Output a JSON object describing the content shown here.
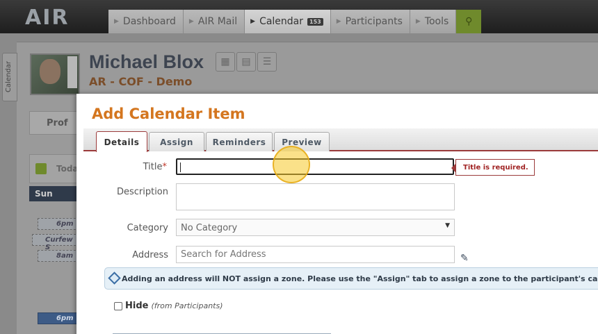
{
  "app": {
    "logo": "AIR",
    "nav": [
      {
        "label": "Dashboard",
        "active": false
      },
      {
        "label": "AIR Mail",
        "active": false
      },
      {
        "label": "Calendar",
        "active": true,
        "badge": "153"
      },
      {
        "label": "Participants",
        "active": false
      },
      {
        "label": "Tools",
        "active": false
      }
    ],
    "side_tab": "Calendar"
  },
  "profile": {
    "name": "Michael Blox",
    "org": "AR - COF - Demo",
    "profile_tab": "Prof",
    "today_label": "Toda",
    "day_header": "Sun",
    "events": [
      {
        "time": "6pm"
      },
      {
        "label": "Curfew S"
      },
      {
        "time": "8am"
      },
      {
        "time": "6pm"
      }
    ]
  },
  "modal": {
    "title": "Add Calendar Item",
    "tabs": [
      {
        "label": "Details",
        "active": true
      },
      {
        "label": "Assign",
        "active": false
      },
      {
        "label": "Reminders",
        "active": false
      },
      {
        "label": "Preview",
        "active": false
      }
    ],
    "form": {
      "title_label": "Title",
      "title_required_mark": "*",
      "title_value": "",
      "title_error": "Title is required.",
      "description_label": "Description",
      "description_value": "",
      "category_label": "Category",
      "category_value": "No Category",
      "address_label": "Address",
      "address_placeholder": "Search for Address",
      "info_message": "Adding an address will NOT assign a zone. Please use the \"Assign\" tab to assign a zone to the participant's calendar item(s",
      "hide_label": "Hide",
      "hide_note": "(from Participants)",
      "hide_checked": false
    }
  },
  "colors": {
    "accent_orange": "#d4761f",
    "error_red": "#a02323",
    "info_blue": "#3b6ea5",
    "active_green": "#6f8a2c"
  }
}
